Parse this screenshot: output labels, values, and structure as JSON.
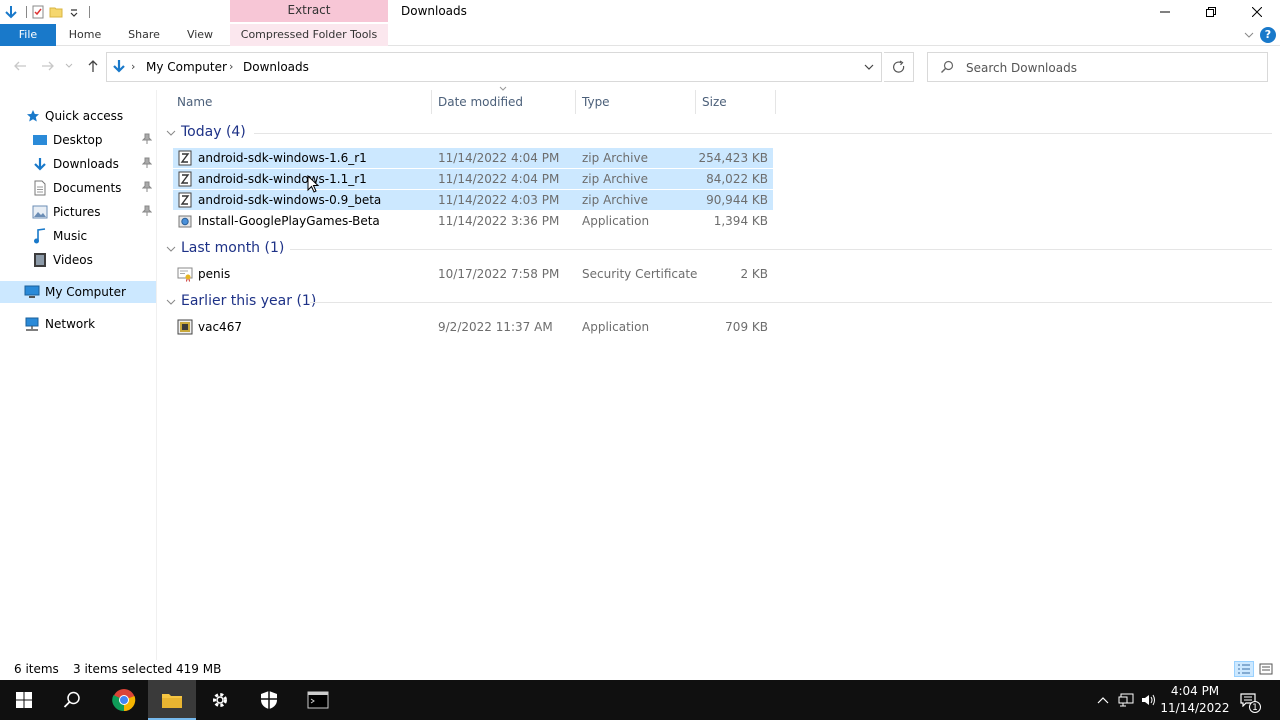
{
  "window": {
    "title": "Downloads",
    "context_tab_header": "Extract"
  },
  "ribbon": {
    "tabs": [
      {
        "label": "File"
      },
      {
        "label": "Home"
      },
      {
        "label": "Share"
      },
      {
        "label": "View"
      },
      {
        "label": "Compressed Folder Tools"
      }
    ]
  },
  "address": {
    "crumbs": [
      "My Computer",
      "Downloads"
    ]
  },
  "search": {
    "placeholder": "Search Downloads"
  },
  "navpane": {
    "quick_access": "Quick access",
    "items": [
      {
        "label": "Desktop",
        "pinned": true
      },
      {
        "label": "Downloads",
        "pinned": true
      },
      {
        "label": "Documents",
        "pinned": true
      },
      {
        "label": "Pictures",
        "pinned": true
      },
      {
        "label": "Music",
        "pinned": false
      },
      {
        "label": "Videos",
        "pinned": false
      }
    ],
    "this_pc": "My Computer",
    "network": "Network"
  },
  "columns": {
    "name": "Name",
    "date": "Date modified",
    "type": "Type",
    "size": "Size"
  },
  "groups": [
    {
      "label": "Today (4)",
      "files": [
        {
          "name": "android-sdk-windows-1.6_r1",
          "date": "11/14/2022 4:04 PM",
          "type": "zip Archive",
          "size": "254,423 KB",
          "selected": true,
          "icon": "zip-icon"
        },
        {
          "name": "android-sdk-windows-1.1_r1",
          "date": "11/14/2022 4:04 PM",
          "type": "zip Archive",
          "size": "84,022 KB",
          "selected": true,
          "icon": "zip-icon"
        },
        {
          "name": "android-sdk-windows-0.9_beta",
          "date": "11/14/2022 4:03 PM",
          "type": "zip Archive",
          "size": "90,944 KB",
          "selected": true,
          "icon": "zip-icon"
        },
        {
          "name": "Install-GooglePlayGames-Beta",
          "date": "11/14/2022 3:36 PM",
          "type": "Application",
          "size": "1,394 KB",
          "selected": false,
          "icon": "installer-icon"
        }
      ]
    },
    {
      "label": "Last month (1)",
      "files": [
        {
          "name": "penis",
          "date": "10/17/2022 7:58 PM",
          "type": "Security Certificate",
          "size": "2 KB",
          "selected": false,
          "icon": "certificate-icon"
        }
      ]
    },
    {
      "label": "Earlier this year (1)",
      "files": [
        {
          "name": "vac467",
          "date": "9/2/2022 11:37 AM",
          "type": "Application",
          "size": "709 KB",
          "selected": false,
          "icon": "application-icon"
        }
      ]
    }
  ],
  "status": {
    "count": "6 items",
    "selection": "3 items selected",
    "size": "419 MB"
  },
  "taskbar": {
    "time": "4:04 PM",
    "date": "11/14/2022",
    "notifications": "1"
  },
  "colors": {
    "accent": "#1979ca",
    "selection": "#cce8ff",
    "group_header": "#1e3287",
    "context_tab": "#f7c6d6"
  }
}
